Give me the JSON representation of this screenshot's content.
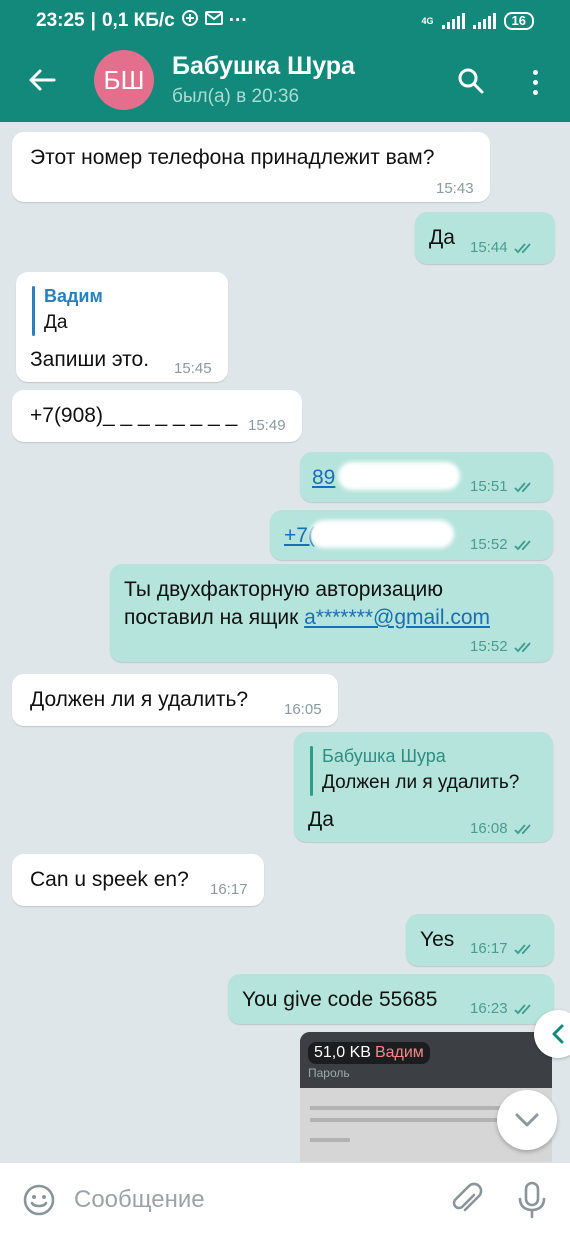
{
  "status_bar": {
    "time": "23:25",
    "speed": "0,1 КБ/с",
    "network": "4G",
    "battery": "16"
  },
  "header": {
    "avatar_initials": "БШ",
    "name": "Бабушка Шура",
    "status": "был(а) в 20:36",
    "colors": {
      "bar": "#12897b",
      "avatar": "#e46f8d"
    }
  },
  "messages": [
    {
      "dir": "in",
      "text": "Этот номер телефона принадлежит вам?",
      "time": "15:43"
    },
    {
      "dir": "out",
      "text": "Да",
      "time": "15:44"
    },
    {
      "dir": "in",
      "reply_name": "Вадим",
      "reply_text": "Да",
      "text": "Запиши это.",
      "time": "15:45"
    },
    {
      "dir": "in",
      "text": "+7(908)_ _ _ _ _ _ _ _",
      "time": "15:49"
    },
    {
      "dir": "out",
      "text": "89",
      "time": "15:51"
    },
    {
      "dir": "out",
      "text": "+7(",
      "time": "15:52"
    },
    {
      "dir": "out",
      "line1": "Ты двухфакторную авторизацию",
      "line2_prefix": "поставил на ящик ",
      "email": "a*******@gmail.com",
      "time": "15:52"
    },
    {
      "dir": "in",
      "text": "Должен ли я удалить?",
      "time": "16:05"
    },
    {
      "dir": "out",
      "reply_name": "Бабушка Шура",
      "reply_text": "Должен ли я удалить?",
      "text": "Да",
      "time": "16:08"
    },
    {
      "dir": "in",
      "text": "Can u speek en?",
      "time": "16:17"
    },
    {
      "dir": "out",
      "text": "Yes",
      "time": "16:17"
    },
    {
      "dir": "out",
      "text": "You give code 55685",
      "time": "16:23"
    }
  ],
  "media": {
    "size": "51,0 KB",
    "sender": "Вадим",
    "header": "Пароль"
  },
  "input": {
    "placeholder": "Сообщение"
  }
}
